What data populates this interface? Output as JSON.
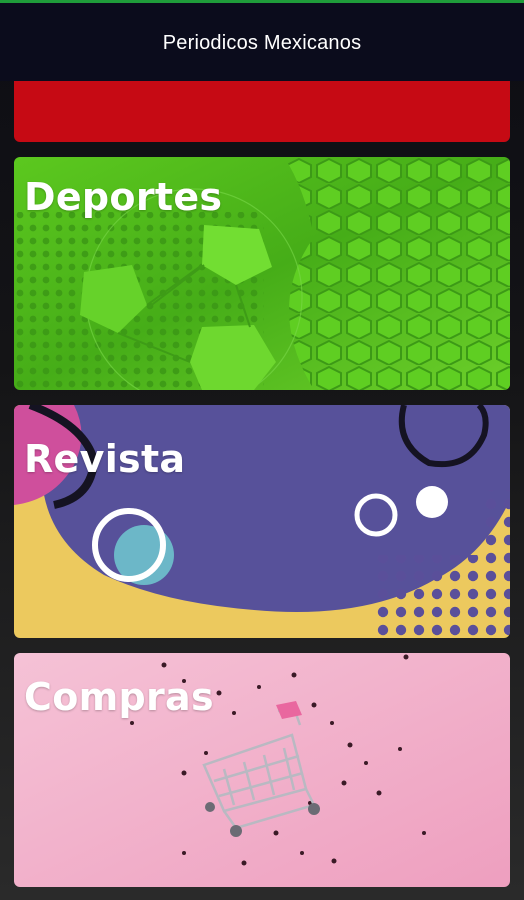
{
  "app_bar": {
    "title": "Periodicos Mexicanos"
  },
  "categories": [
    {
      "label": ""
    },
    {
      "label": "Deportes"
    },
    {
      "label": "Revista"
    },
    {
      "label": "Compras"
    }
  ],
  "colors": {
    "app_bar": "#0b0c1c",
    "top_accent": "#1f9d3a",
    "red_card": "#c60a14",
    "deportes_green": "#4cb81c",
    "revista_purple": "#57519a",
    "revista_yellow": "#ecc95e",
    "compras_pink": "#f2b8cf"
  },
  "icons": {
    "deportes": "soccer-ball-icon",
    "revista": "abstract-shapes-icon",
    "compras": "shopping-cart-icon"
  }
}
